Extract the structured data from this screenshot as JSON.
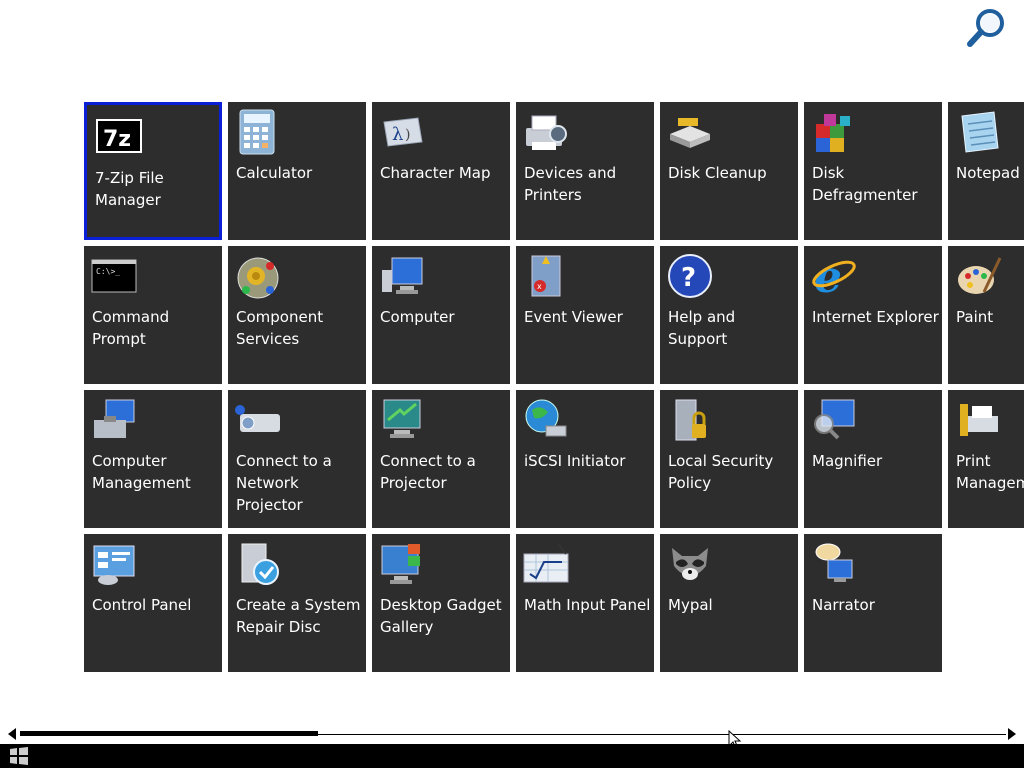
{
  "colors": {
    "background": "#ffffff",
    "tile": "#2d2d2d",
    "tile_text": "#ffffff",
    "selection_border": "#0a1fd6",
    "taskbar": "#000000"
  },
  "search": {
    "icon": "search-magnifier-icon"
  },
  "scrollbar": {
    "thumb_position_fraction": 0.0,
    "thumb_size_fraction": 0.3
  },
  "tiles": [
    {
      "label": "7-Zip File\nManager",
      "icon": "7zip-icon",
      "selected": true
    },
    {
      "label": "Calculator",
      "icon": "calculator-icon"
    },
    {
      "label": "Character Map",
      "icon": "character-map-icon"
    },
    {
      "label": "Devices and\nPrinters",
      "icon": "devices-printers-icon"
    },
    {
      "label": "Disk Cleanup",
      "icon": "disk-cleanup-icon"
    },
    {
      "label": "Disk\nDefragmenter",
      "icon": "disk-defragmenter-icon"
    },
    {
      "label": "Notepad",
      "icon": "notepad-icon"
    },
    {
      "label": "Command\nPrompt",
      "icon": "command-prompt-icon"
    },
    {
      "label": "Component\nServices",
      "icon": "component-services-icon"
    },
    {
      "label": "Computer",
      "icon": "computer-icon"
    },
    {
      "label": "Event Viewer",
      "icon": "event-viewer-icon"
    },
    {
      "label": "Help and\nSupport",
      "icon": "help-support-icon"
    },
    {
      "label": "Internet Explorer",
      "icon": "internet-explorer-icon"
    },
    {
      "label": "Paint",
      "icon": "paint-icon"
    },
    {
      "label": "Computer\nManagement",
      "icon": "computer-management-icon"
    },
    {
      "label": "Connect to a\nNetwork\nProjector",
      "icon": "network-projector-icon"
    },
    {
      "label": "Connect to a\nProjector",
      "icon": "projector-icon"
    },
    {
      "label": "iSCSI Initiator",
      "icon": "iscsi-initiator-icon"
    },
    {
      "label": "Local Security\nPolicy",
      "icon": "local-security-policy-icon"
    },
    {
      "label": "Magnifier",
      "icon": "magnifier-icon"
    },
    {
      "label": "Print\nManagem",
      "icon": "print-management-icon"
    },
    {
      "label": "Control Panel",
      "icon": "control-panel-icon"
    },
    {
      "label": "Create a System\nRepair Disc",
      "icon": "repair-disc-icon"
    },
    {
      "label": "Desktop Gadget\nGallery",
      "icon": "gadget-gallery-icon"
    },
    {
      "label": "Math Input Panel",
      "icon": "math-input-icon"
    },
    {
      "label": "Mypal",
      "icon": "mypal-icon"
    },
    {
      "label": "Narrator",
      "icon": "narrator-icon"
    }
  ],
  "taskbar": {
    "start_icon": "windows-start-icon"
  }
}
